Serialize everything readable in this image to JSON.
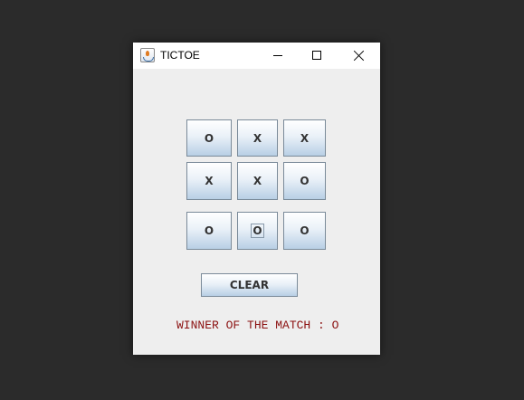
{
  "window": {
    "title": "TICTOE",
    "icon": "java-cup-icon"
  },
  "board": {
    "cells": [
      [
        "O",
        "X",
        "X"
      ],
      [
        "X",
        "X",
        "O"
      ],
      [
        "O",
        "O",
        "O"
      ]
    ],
    "focused_cell": "2.1"
  },
  "controls": {
    "clear_label": "CLEAR"
  },
  "status": {
    "text": "WINNER OF THE MATCH : O",
    "color": "#8b1010"
  },
  "colors": {
    "desktop": "#2b2b2b",
    "window_bg": "#eeeeee",
    "button_gradient_top": "#ffffff",
    "button_gradient_bottom": "#b8cfe5"
  }
}
